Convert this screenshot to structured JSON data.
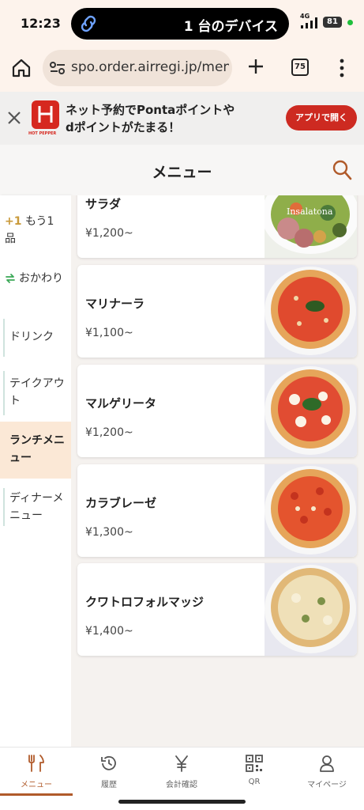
{
  "status_bar": {
    "time": "12:23",
    "island_text": "1 台のデバイス",
    "network": "4G",
    "battery": "81"
  },
  "browser": {
    "url": "spo.order.airregi.jp/men",
    "tab_count": "75"
  },
  "app_banner": {
    "line1": "ネット予約でPontaポイントや",
    "line2": "dポイントがたまる！",
    "logo_text": "HOT PEPPER",
    "button": "アプリで開く",
    "brand_color": "#cd2a21"
  },
  "header": {
    "title": "メニュー"
  },
  "sidebar": {
    "items": [
      {
        "icon": "plus-one",
        "label": "もう1品",
        "prefix": "+1"
      },
      {
        "icon": "refill-icon",
        "label": "おかわり"
      },
      {
        "label": "ドリンク"
      },
      {
        "label": "テイクアウト"
      },
      {
        "label": "ランチメニュー",
        "active": true
      },
      {
        "label": "ディナーメニュー"
      }
    ]
  },
  "menu_items": [
    {
      "name": "サラダ",
      "price": "¥1,200~",
      "image_text": "Insalatona"
    },
    {
      "name": "マリナーラ",
      "price": "¥1,100~"
    },
    {
      "name": "マルゲリータ",
      "price": "¥1,200~"
    },
    {
      "name": "カラブレーゼ",
      "price": "¥1,300~"
    },
    {
      "name": "クワトロフォルマッジ",
      "price": "¥1,400~"
    }
  ],
  "bottom_nav": [
    {
      "icon": "fork-knife-icon",
      "label": "メニュー",
      "active": true
    },
    {
      "icon": "history-icon",
      "label": "履歴"
    },
    {
      "icon": "yen-icon",
      "label": "会計確認"
    },
    {
      "icon": "qr-icon",
      "label": "QR"
    },
    {
      "icon": "person-icon",
      "label": "マイページ"
    }
  ],
  "accent_color": "#b05a2a"
}
